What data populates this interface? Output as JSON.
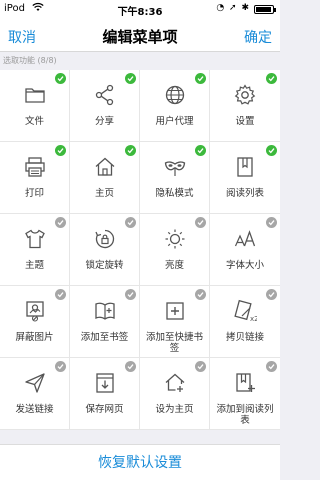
{
  "status_bar": {
    "carrier": "iPod",
    "time": "下午8:36",
    "right_icons": "◔ ➚ ✱",
    "battery_level": 0.85
  },
  "nav": {
    "cancel_label": "取消",
    "title": "编辑菜单项",
    "confirm_label": "确定"
  },
  "section_label": "选取功能 (8/8)",
  "items": [
    {
      "label": "文件",
      "icon": "folder-icon",
      "selected": true
    },
    {
      "label": "分享",
      "icon": "share-icon",
      "selected": true
    },
    {
      "label": "用户代理",
      "icon": "globe-icon",
      "selected": true
    },
    {
      "label": "设置",
      "icon": "gear-icon",
      "selected": true
    },
    {
      "label": "打印",
      "icon": "printer-icon",
      "selected": true
    },
    {
      "label": "主页",
      "icon": "home-icon",
      "selected": true
    },
    {
      "label": "隐私模式",
      "icon": "mask-icon",
      "selected": true
    },
    {
      "label": "阅读列表",
      "icon": "reading-list-icon",
      "selected": true
    },
    {
      "label": "主题",
      "icon": "tshirt-icon",
      "selected": false
    },
    {
      "label": "锁定旋转",
      "icon": "rotation-lock-icon",
      "selected": false
    },
    {
      "label": "亮度",
      "icon": "brightness-icon",
      "selected": false
    },
    {
      "label": "字体大小",
      "icon": "font-size-icon",
      "selected": false
    },
    {
      "label": "屏蔽图片",
      "icon": "block-image-icon",
      "selected": false
    },
    {
      "label": "添加至书签",
      "icon": "add-bookmark-icon",
      "selected": false
    },
    {
      "label": "添加至快捷书签",
      "icon": "add-quick-bookmark-icon",
      "selected": false
    },
    {
      "label": "拷贝链接",
      "icon": "copy-link-icon",
      "selected": false
    },
    {
      "label": "发送链接",
      "icon": "send-icon",
      "selected": false
    },
    {
      "label": "保存网页",
      "icon": "save-page-icon",
      "selected": false
    },
    {
      "label": "设为主页",
      "icon": "set-home-icon",
      "selected": false
    },
    {
      "label": "添加到阅读列表",
      "icon": "add-reading-list-icon",
      "selected": false
    }
  ],
  "bottom": {
    "reset_label": "恢复默认设置"
  },
  "colors": {
    "accent": "#1a8cd8",
    "selected_badge": "#3cb93c",
    "unselected_badge": "#a6a6a6",
    "background": "#efeff4"
  }
}
